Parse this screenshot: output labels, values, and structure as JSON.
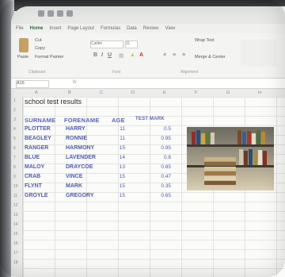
{
  "app": {
    "tabs": [
      "File",
      "Home",
      "Insert",
      "Page Layout",
      "Formulas",
      "Data",
      "Review",
      "View"
    ],
    "active_tab": "Home"
  },
  "ribbon": {
    "paste_label": "Paste",
    "cut_label": "Cut",
    "copy_label": "Copy",
    "format_painter_label": "Format Painter",
    "clipboard_group": "Clipboard",
    "font_name": "Calibri",
    "font_size": "11",
    "font_group": "Font",
    "alignment_group": "Alignment",
    "wrap_text_label": "Wrap Text",
    "merge_label": "Merge & Center"
  },
  "formula_bar": {
    "namebox": "A15",
    "fx": "fx"
  },
  "columns": [
    "A",
    "B",
    "C",
    "D",
    "E",
    "F",
    "G",
    "H"
  ],
  "sheet": {
    "title": "school test results",
    "headers": {
      "surname": "SURNAME",
      "forename": "FORENAME",
      "age": "AGE",
      "test_mark": "TEST MARK"
    },
    "rows": [
      {
        "surname": "PLOTTER",
        "forename": "HARRY",
        "age": "11",
        "mark": "0.5"
      },
      {
        "surname": "BEAGLEY",
        "forename": "RONNIE",
        "age": "11",
        "mark": "0.95"
      },
      {
        "surname": "RANGER",
        "forename": "HARMONY",
        "age": "15",
        "mark": "0.95"
      },
      {
        "surname": "BLUE",
        "forename": "LAVENDER",
        "age": "14",
        "mark": "0.8"
      },
      {
        "surname": "MALOY",
        "forename": "DRAYCOE",
        "age": "13",
        "mark": "0.85"
      },
      {
        "surname": "CRAB",
        "forename": "VINCE",
        "age": "15",
        "mark": "0.47"
      },
      {
        "surname": "FLYNT",
        "forename": "MARK",
        "age": "15",
        "mark": "0.35"
      },
      {
        "surname": "GROYLE",
        "forename": "GREGORY",
        "age": "15",
        "mark": "0.65"
      }
    ]
  },
  "row_numbers": [
    "1",
    "2",
    "3",
    "4",
    "5",
    "6",
    "7",
    "8",
    "9",
    "10",
    "11",
    "12",
    "13",
    "14",
    "15",
    "16",
    "17",
    "18"
  ],
  "image": {
    "name": "bookshelf-photo"
  }
}
